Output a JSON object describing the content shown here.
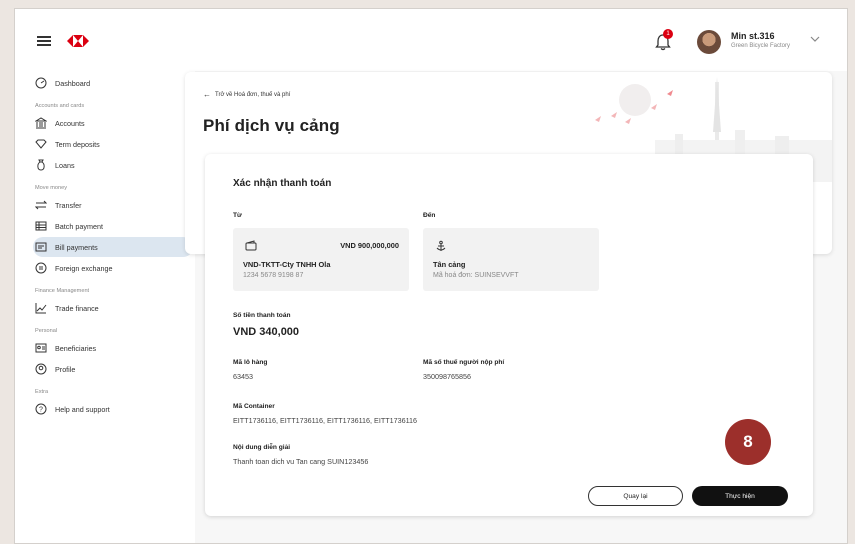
{
  "header": {
    "notification_count": "1",
    "user_name": "Min st.316",
    "user_company": "Green Bicycle Factory"
  },
  "sidebar": {
    "dashboard": "Dashboard",
    "section_accounts": "Accounts and cards",
    "accounts": "Accounts",
    "term_deposits": "Term deposits",
    "loans": "Loans",
    "section_move": "Move money",
    "transfer": "Transfer",
    "batch_payment": "Batch payment",
    "bill_payments": "Bill payments",
    "foreign_exchange": "Foreign exchange",
    "section_finance": "Finance Management",
    "trade_finance": "Trade finance",
    "section_personal": "Personal",
    "beneficiaries": "Beneficiaries",
    "profile": "Profile",
    "section_extra": "Extra",
    "help": "Help and support"
  },
  "page": {
    "back_link": "Trở về Hoá đơn, thuế và phí",
    "title": "Phí dịch vụ cảng"
  },
  "card": {
    "title": "Xác nhận thanh toán",
    "from_label": "Từ",
    "to_label": "Đến",
    "from_amount": "VND 900,000,000",
    "from_name": "VND-TKTT-Cty TNHH Ola",
    "from_number": "1234 5678 9198 87",
    "to_name": "Tân cảng",
    "to_invoice": "Mã hoá đơn: SUINSEVVFT",
    "amount_label": "Số tiền thanh toán",
    "amount_value": "VND 340,000",
    "lot_label": "Mã lô hàng",
    "lot_value": "63453",
    "tax_label": "Mã số thuế người nộp phí",
    "tax_value": "350098765856",
    "container_label": "Mã Container",
    "container_value": "EITT1736116, EITT1736116, EITT1736116, EITT1736116",
    "desc_label": "Nội dung diễn giải",
    "desc_value": "Thanh toan dich vu Tan cang SUIN123456",
    "back_button": "Quay lại",
    "submit_button": "Thực hiện"
  },
  "step_badge": "8",
  "colors": {
    "brand_red": "#db0011",
    "active_bg": "#dce6f0",
    "badge": "#9c2f2b"
  }
}
